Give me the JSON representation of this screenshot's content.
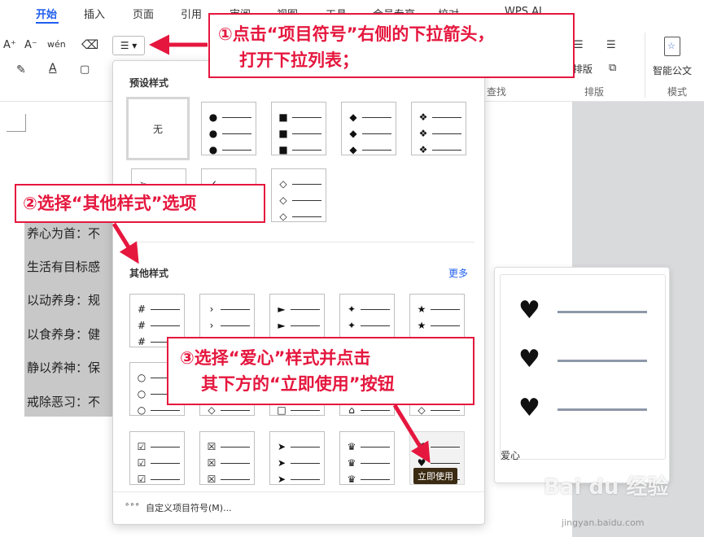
{
  "tabs": [
    {
      "label": "开始",
      "active": true
    },
    {
      "label": "插入"
    },
    {
      "label": "页面"
    },
    {
      "label": "引用"
    },
    {
      "label": "审阅"
    },
    {
      "label": "视图"
    },
    {
      "label": "工具"
    },
    {
      "label": "会员专享"
    },
    {
      "label": "校对"
    },
    {
      "label": "WPS AI"
    }
  ],
  "ribbon": {
    "font_grow": "A⁺",
    "font_shrink": "A⁻",
    "phonetic": "wén",
    "eraser_icon": "eraser-icon",
    "arrange_label": "排版",
    "group_find": "查找",
    "group_arrange": "排版",
    "group_template": "模式",
    "smart_doc_label": "智能公文",
    "list_button_glyph": "☰"
  },
  "document": {
    "lines": [
      "养心为首：不",
      "生活有目标感",
      "以动养身：规",
      "以食养身：健",
      "静以养神：保",
      "戒除恶习：不"
    ]
  },
  "dropdown": {
    "preset_title": "预设样式",
    "none_label": "无",
    "preset_styles": [
      {
        "glyph": ""
      },
      {
        "glyph": "●"
      },
      {
        "glyph": "■"
      },
      {
        "glyph": "◆"
      },
      {
        "glyph": "❖"
      },
      {
        "glyph": "➢"
      },
      {
        "glyph": "✓"
      },
      {
        "glyph": "◇"
      }
    ],
    "other_title": "其他样式",
    "more_label": "更多",
    "other_styles": [
      {
        "glyph": "#"
      },
      {
        "glyph": "›"
      },
      {
        "glyph": "►"
      },
      {
        "glyph": "✦"
      },
      {
        "glyph": "★"
      },
      {
        "glyph": "○"
      },
      {
        "glyph": "◇"
      },
      {
        "glyph": "□"
      },
      {
        "glyph": "⌂"
      },
      {
        "glyph": "◇"
      },
      {
        "glyph": "☑"
      },
      {
        "glyph": "☒"
      },
      {
        "glyph": "➤"
      },
      {
        "glyph": "♛"
      },
      {
        "glyph": "♥"
      }
    ],
    "use_now_tooltip": "立即使用",
    "footer_label": "自定义项目符号(M)..."
  },
  "preview": {
    "glyph": "♥",
    "name": "爱心"
  },
  "callouts": {
    "step1_line1": "①点击“项目符号”右侧的下拉箭头，",
    "step1_line2": "打开下拉列表；",
    "step2": "②选择“其他样式”选项",
    "step3_line1": "③选择“爱心”样式并点击",
    "step3_line2": "其下方的“立即使用”按钮"
  },
  "watermark": {
    "brand": "Bai du 经验",
    "url": "jingyan.baidu.com"
  },
  "colors": {
    "accent": "#1f5ef0",
    "callout_red": "#e5173e",
    "preview_line": "#8d98a8"
  }
}
